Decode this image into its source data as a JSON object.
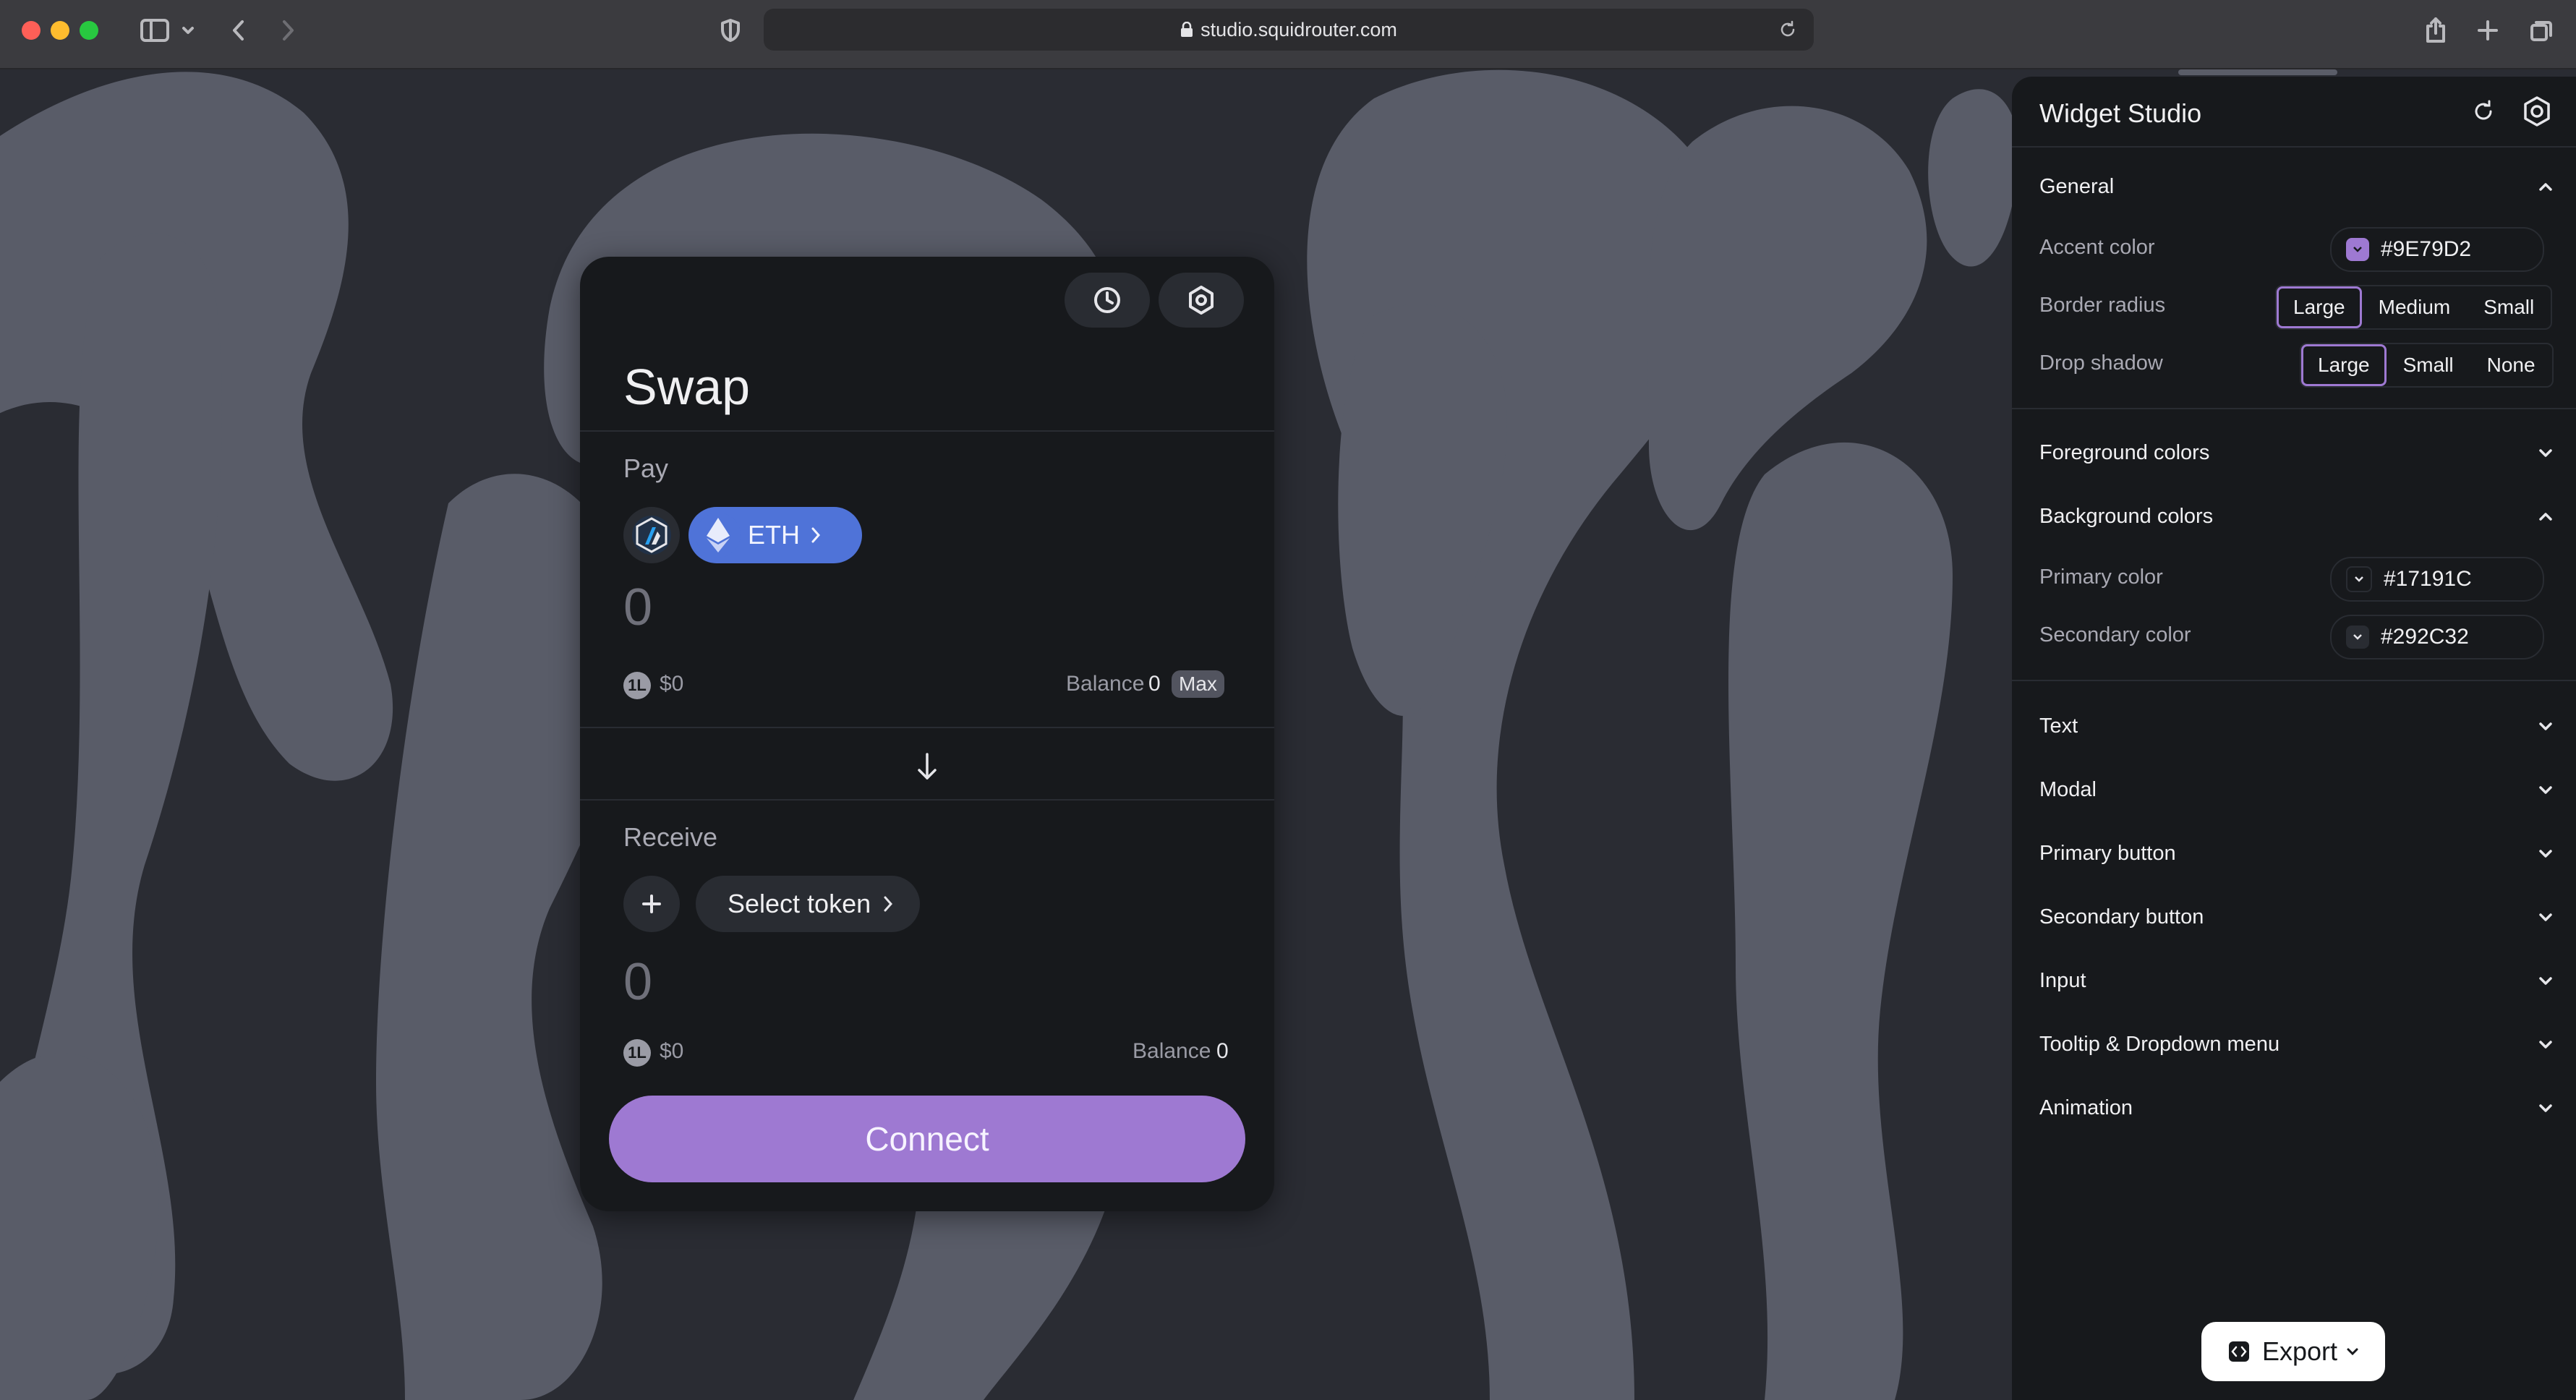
{
  "browser": {
    "url": "studio.squidrouter.com"
  },
  "widget": {
    "title": "Swap",
    "pay": {
      "label": "Pay",
      "token": "ETH",
      "amount": "0",
      "usd": "$0",
      "balance_label": "Balance",
      "balance_value": "0",
      "max_label": "Max"
    },
    "receive": {
      "label": "Receive",
      "token_placeholder": "Select token",
      "amount": "0",
      "usd": "$0",
      "balance_label": "Balance",
      "balance_value": "0"
    },
    "connect_label": "Connect"
  },
  "studio": {
    "title": "Widget Studio",
    "general": {
      "label": "General",
      "accent_label": "Accent color",
      "accent_value": "#9E79D2",
      "radius_label": "Border radius",
      "radius_options": [
        "Large",
        "Medium",
        "Small"
      ],
      "radius_selected": "Large",
      "shadow_label": "Drop shadow",
      "shadow_options": [
        "Large",
        "Small",
        "None"
      ],
      "shadow_selected": "Large"
    },
    "foreground_label": "Foreground colors",
    "background": {
      "label": "Background colors",
      "primary_label": "Primary color",
      "primary_value": "#17191C",
      "secondary_label": "Secondary color",
      "secondary_value": "#292C32"
    },
    "sections": [
      "Text",
      "Modal",
      "Primary button",
      "Secondary button",
      "Input",
      "Tooltip & Dropdown menu",
      "Animation"
    ],
    "export_label": "Export"
  },
  "colors": {
    "accent": "#9E79D2",
    "primary_bg": "#17191C",
    "secondary_bg": "#292C32",
    "canvas": "#2A2C33",
    "shapes": "#595C68"
  }
}
